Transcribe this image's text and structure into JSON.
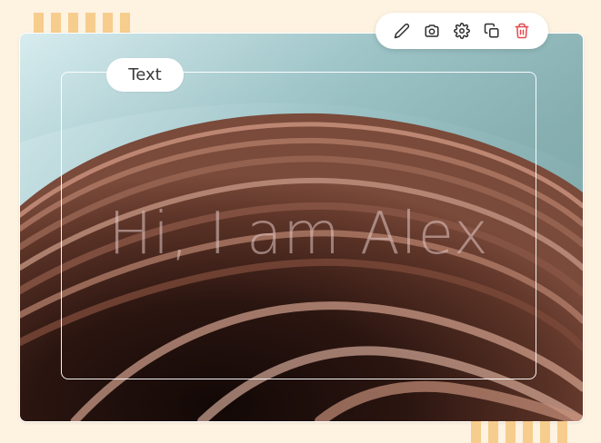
{
  "element_type_label": "Text",
  "heading_text": "Hi, I am Alex",
  "toolbar": {
    "icons": [
      "pencil-icon",
      "camera-icon",
      "gear-icon",
      "copy-icon",
      "trash-icon"
    ]
  },
  "colors": {
    "page_bg": "#fef2e1",
    "stripe": "#f6cd8d",
    "delete_red": "#e5484d",
    "icon_dark": "#2d2d2d"
  }
}
